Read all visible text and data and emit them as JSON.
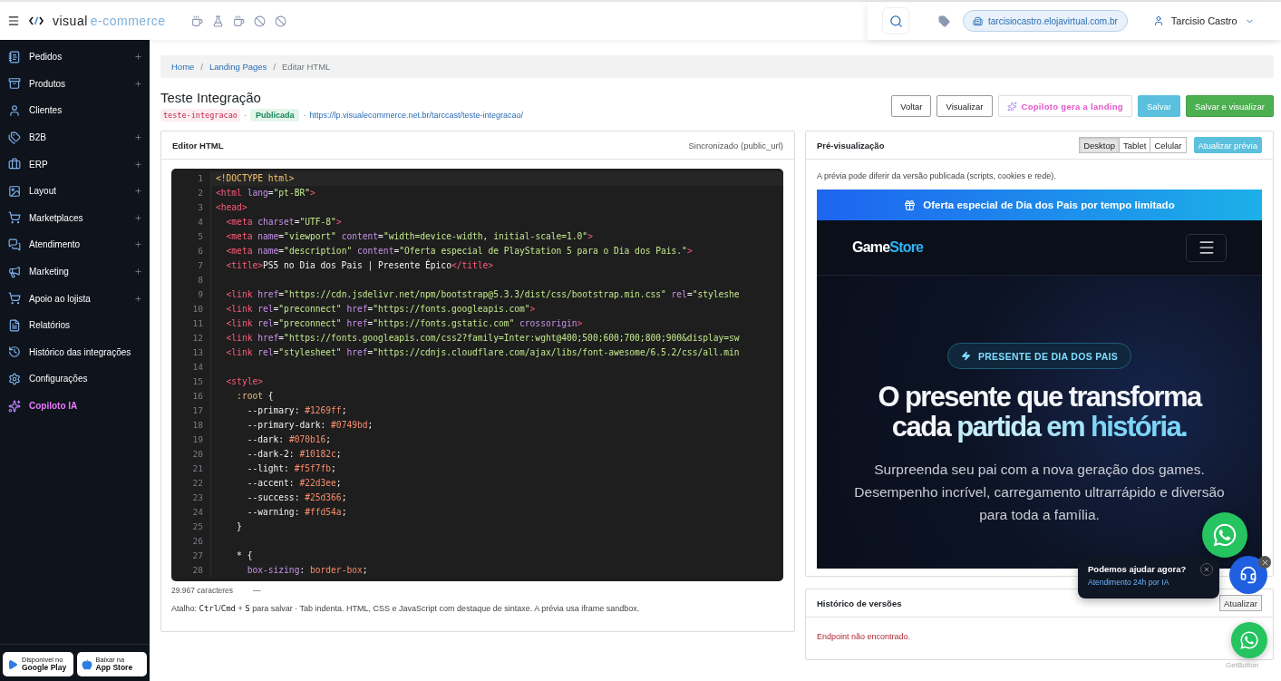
{
  "topbar": {
    "brand_a": "visual",
    "brand_b": "e-commerce",
    "domain": "tarcisiocastro.elojavirtual.com.br",
    "user": "Tarcisio Castro"
  },
  "sidebar": {
    "items": [
      {
        "label": "Pedidos",
        "kind": "menu",
        "expandable": true
      },
      {
        "label": "Produtos",
        "kind": "menu",
        "expandable": true
      },
      {
        "label": "Clientes",
        "kind": "menu",
        "expandable": false
      },
      {
        "label": "B2B",
        "kind": "menu",
        "expandable": true
      },
      {
        "label": "ERP",
        "kind": "menu",
        "expandable": true
      },
      {
        "label": "Layout",
        "kind": "menu",
        "expandable": true
      },
      {
        "label": "Marketplaces",
        "kind": "menu",
        "expandable": true
      },
      {
        "label": "Atendimento",
        "kind": "menu",
        "expandable": true
      },
      {
        "label": "Marketing",
        "kind": "menu",
        "expandable": true
      },
      {
        "label": "Apoio ao lojista",
        "kind": "menu",
        "expandable": true
      },
      {
        "label": "Relatórios",
        "kind": "menu",
        "expandable": false
      },
      {
        "label": "Histórico das integrações",
        "kind": "menu",
        "expandable": false
      },
      {
        "label": "Configurações",
        "kind": "menu",
        "expandable": false
      },
      {
        "label": "Copiloto IA",
        "kind": "ai",
        "expandable": false
      }
    ],
    "stores": [
      {
        "small": "Disponível no",
        "big": "Google Play"
      },
      {
        "small": "Baixar na",
        "big": "App Store"
      }
    ]
  },
  "breadcrumb": [
    {
      "label": "Home",
      "kind": "link"
    },
    {
      "label": "/",
      "kind": "sep"
    },
    {
      "label": "Landing Pages",
      "kind": "link"
    },
    {
      "label": "/",
      "kind": "sep"
    },
    {
      "label": "Editar HTML",
      "kind": "current"
    }
  ],
  "page": {
    "title": "Teste Integração",
    "meta": [
      {
        "text": "teste-integracao",
        "kind": "slug"
      },
      {
        "text": "·",
        "kind": "sep"
      },
      {
        "text": "Publicada",
        "kind": "status"
      },
      {
        "text": "·",
        "kind": "sep"
      },
      {
        "text": "https://lp.visualecommerce.net.br/tarccast/teste-integracao/",
        "kind": "link"
      }
    ]
  },
  "actions": [
    {
      "label": "Voltar",
      "kind": "outline"
    },
    {
      "label": "Visualizar",
      "kind": "outline"
    },
    {
      "label": "Copiloto gera a landing",
      "kind": "ai"
    },
    {
      "label": "Salvar",
      "kind": "info"
    },
    {
      "label": "Salvar e visualizar",
      "kind": "success"
    }
  ],
  "editor": {
    "title": "Editor HTML",
    "sync": "Sincronizado (public_url)",
    "lines": [
      {
        "n": "1",
        "code": [
          {
            "text": "<!DOCTYPE html>",
            "kind": "doctype"
          }
        ]
      },
      {
        "n": "2",
        "code": [
          {
            "text": "<html",
            "kind": "tag"
          },
          {
            "text": " lang",
            "kind": "attr"
          },
          {
            "text": "=",
            "kind": "plain"
          },
          {
            "text": "\"pt-BR\"",
            "kind": "str"
          },
          {
            "text": ">",
            "kind": "tag"
          }
        ]
      },
      {
        "n": "3",
        "code": [
          {
            "text": "<head>",
            "kind": "tag"
          }
        ]
      },
      {
        "n": "4",
        "code": [
          {
            "text": "  <meta",
            "kind": "tag"
          },
          {
            "text": " charset",
            "kind": "attr"
          },
          {
            "text": "=",
            "kind": "plain"
          },
          {
            "text": "\"UTF-8\"",
            "kind": "str"
          },
          {
            "text": ">",
            "kind": "tag"
          }
        ]
      },
      {
        "n": "5",
        "code": [
          {
            "text": "  <meta",
            "kind": "tag"
          },
          {
            "text": " name",
            "kind": "attr"
          },
          {
            "text": "=",
            "kind": "plain"
          },
          {
            "text": "\"viewport\"",
            "kind": "str"
          },
          {
            "text": " content",
            "kind": "attr"
          },
          {
            "text": "=",
            "kind": "plain"
          },
          {
            "text": "\"width=device-width, initial-scale=1.0\"",
            "kind": "str"
          },
          {
            "text": ">",
            "kind": "tag"
          }
        ]
      },
      {
        "n": "6",
        "code": [
          {
            "text": "  <meta",
            "kind": "tag"
          },
          {
            "text": " name",
            "kind": "attr"
          },
          {
            "text": "=",
            "kind": "plain"
          },
          {
            "text": "\"description\"",
            "kind": "str"
          },
          {
            "text": " content",
            "kind": "attr"
          },
          {
            "text": "=",
            "kind": "plain"
          },
          {
            "text": "\"Oferta especial de PlayStation 5 para o Dia dos Pais.\"",
            "kind": "str"
          },
          {
            "text": ">",
            "kind": "tag"
          }
        ]
      },
      {
        "n": "7",
        "code": [
          {
            "text": "  <title>",
            "kind": "tag"
          },
          {
            "text": "PS5 no Dia dos Pais | Presente Épico",
            "kind": "plain"
          },
          {
            "text": "</title>",
            "kind": "tag"
          }
        ]
      },
      {
        "n": "8"
      },
      {
        "n": "9",
        "code": [
          {
            "text": "  <link",
            "kind": "tag"
          },
          {
            "text": " href",
            "kind": "attr"
          },
          {
            "text": "=",
            "kind": "plain"
          },
          {
            "text": "\"https://cdn.jsdelivr.net/npm/bootstrap@5.3.3/dist/css/bootstrap.min.css\"",
            "kind": "str"
          },
          {
            "text": " rel",
            "kind": "attr"
          },
          {
            "text": "=",
            "kind": "plain"
          },
          {
            "text": "\"styleshe",
            "kind": "str"
          }
        ]
      },
      {
        "n": "10",
        "code": [
          {
            "text": "  <link",
            "kind": "tag"
          },
          {
            "text": " rel",
            "kind": "attr"
          },
          {
            "text": "=",
            "kind": "plain"
          },
          {
            "text": "\"preconnect\"",
            "kind": "str"
          },
          {
            "text": " href",
            "kind": "attr"
          },
          {
            "text": "=",
            "kind": "plain"
          },
          {
            "text": "\"https://fonts.googleapis.com\"",
            "kind": "str"
          },
          {
            "text": ">",
            "kind": "tag"
          }
        ]
      },
      {
        "n": "11",
        "code": [
          {
            "text": "  <link",
            "kind": "tag"
          },
          {
            "text": " rel",
            "kind": "attr"
          },
          {
            "text": "=",
            "kind": "plain"
          },
          {
            "text": "\"preconnect\"",
            "kind": "str"
          },
          {
            "text": " href",
            "kind": "attr"
          },
          {
            "text": "=",
            "kind": "plain"
          },
          {
            "text": "\"https://fonts.gstatic.com\"",
            "kind": "str"
          },
          {
            "text": " crossorigin",
            "kind": "attr"
          },
          {
            "text": ">",
            "kind": "tag"
          }
        ]
      },
      {
        "n": "12",
        "code": [
          {
            "text": "  <link",
            "kind": "tag"
          },
          {
            "text": " href",
            "kind": "attr"
          },
          {
            "text": "=",
            "kind": "plain"
          },
          {
            "text": "\"https://fonts.googleapis.com/css2?family=Inter:wght@400;500;600;700;800;900&display=sw",
            "kind": "str"
          }
        ]
      },
      {
        "n": "13",
        "code": [
          {
            "text": "  <link",
            "kind": "tag"
          },
          {
            "text": " rel",
            "kind": "attr"
          },
          {
            "text": "=",
            "kind": "plain"
          },
          {
            "text": "\"stylesheet\"",
            "kind": "str"
          },
          {
            "text": " href",
            "kind": "attr"
          },
          {
            "text": "=",
            "kind": "plain"
          },
          {
            "text": "\"https://cdnjs.cloudflare.com/ajax/libs/font-awesome/6.5.2/css/all.min",
            "kind": "str"
          }
        ]
      },
      {
        "n": "14"
      },
      {
        "n": "15",
        "code": [
          {
            "text": "  <style>",
            "kind": "tag"
          }
        ]
      },
      {
        "n": "16",
        "code": [
          {
            "text": "    :root",
            "kind": "sel"
          },
          {
            "text": " {",
            "kind": "plain"
          }
        ]
      },
      {
        "n": "17",
        "code": [
          {
            "text": "      --primary: ",
            "kind": "plain"
          },
          {
            "text": "#1269ff",
            "kind": "val"
          },
          {
            "text": ";",
            "kind": "plain"
          }
        ]
      },
      {
        "n": "18",
        "code": [
          {
            "text": "      --primary-dark: ",
            "kind": "plain"
          },
          {
            "text": "#0749bd",
            "kind": "val"
          },
          {
            "text": ";",
            "kind": "plain"
          }
        ]
      },
      {
        "n": "19",
        "code": [
          {
            "text": "      --dark: ",
            "kind": "plain"
          },
          {
            "text": "#070b16",
            "kind": "val"
          },
          {
            "text": ";",
            "kind": "plain"
          }
        ]
      },
      {
        "n": "20",
        "code": [
          {
            "text": "      --dark-2: ",
            "kind": "plain"
          },
          {
            "text": "#10182c",
            "kind": "val"
          },
          {
            "text": ";",
            "kind": "plain"
          }
        ]
      },
      {
        "n": "21",
        "code": [
          {
            "text": "      --light: ",
            "kind": "plain"
          },
          {
            "text": "#f5f7fb",
            "kind": "val"
          },
          {
            "text": ";",
            "kind": "plain"
          }
        ]
      },
      {
        "n": "22",
        "code": [
          {
            "text": "      --accent: ",
            "kind": "plain"
          },
          {
            "text": "#22d3ee",
            "kind": "val"
          },
          {
            "text": ";",
            "kind": "plain"
          }
        ]
      },
      {
        "n": "23",
        "code": [
          {
            "text": "      --success: ",
            "kind": "plain"
          },
          {
            "text": "#25d366",
            "kind": "val"
          },
          {
            "text": ";",
            "kind": "plain"
          }
        ]
      },
      {
        "n": "24",
        "code": [
          {
            "text": "      --warning: ",
            "kind": "plain"
          },
          {
            "text": "#ffd54a",
            "kind": "val"
          },
          {
            "text": ";",
            "kind": "plain"
          }
        ]
      },
      {
        "n": "25",
        "code": [
          {
            "text": "    }",
            "kind": "plain"
          }
        ]
      },
      {
        "n": "26"
      },
      {
        "n": "27",
        "code": [
          {
            "text": "    * {",
            "kind": "plain"
          }
        ]
      },
      {
        "n": "28",
        "code": [
          {
            "text": "      box-sizing",
            "kind": "attr"
          },
          {
            "text": ": ",
            "kind": "plain"
          },
          {
            "text": "border-box",
            "kind": "val"
          },
          {
            "text": ";",
            "kind": "plain"
          }
        ]
      }
    ],
    "char_count": "29.967 caracteres",
    "dash": "—",
    "hint": [
      {
        "text": "Atalho: ",
        "kind": "text"
      },
      {
        "text": "Ctrl",
        "kind": "code"
      },
      {
        "text": "/",
        "kind": "text"
      },
      {
        "text": "Cmd",
        "kind": "code"
      },
      {
        "text": " + ",
        "kind": "text"
      },
      {
        "text": "S",
        "kind": "code"
      },
      {
        "text": " para salvar · Tab indenta. HTML, CSS e JavaScript com destaque de sintaxe. A prévia usa iframe sandbox.",
        "kind": "text"
      }
    ]
  },
  "preview": {
    "title": "Pré-visualização",
    "devices": [
      {
        "label": "Desktop",
        "selected": true
      },
      {
        "label": "Tablet",
        "selected": false
      },
      {
        "label": "Celular",
        "selected": false
      }
    ],
    "refresh": "Atualizar prévia",
    "note": "A prévia pode diferir da versão publicada (scripts, cookies e rede).",
    "landing": {
      "banner": "Oferta especial de Dia dos Pais por tempo limitado",
      "logo_a": "Game",
      "logo_b": "Store",
      "badge": "PRESENTE DE DIA DOS PAIS",
      "headline": [
        [
          {
            "text": "O presente que transforma",
            "kind": "white"
          }
        ],
        [
          {
            "text": "cada ",
            "kind": "white"
          },
          {
            "text": "partida ",
            "kind": "light"
          },
          {
            "text": "em ",
            "kind": "soft"
          },
          {
            "text": "história.",
            "kind": "accent"
          }
        ]
      ],
      "paragraph": "Surpreenda seu pai com a nova geração dos games. Desempenho incrível, carregamento ultrarrápido e diversão para toda a família."
    }
  },
  "history": {
    "title": "Histórico de versões",
    "refresh": "Atualizar",
    "error": "Endpoint não encontrado."
  },
  "widgets": {
    "chat_title": "Podemos ajudar agora?",
    "chat_subtitle": "Atendimento 24h por IA",
    "brand": "GetButton"
  }
}
